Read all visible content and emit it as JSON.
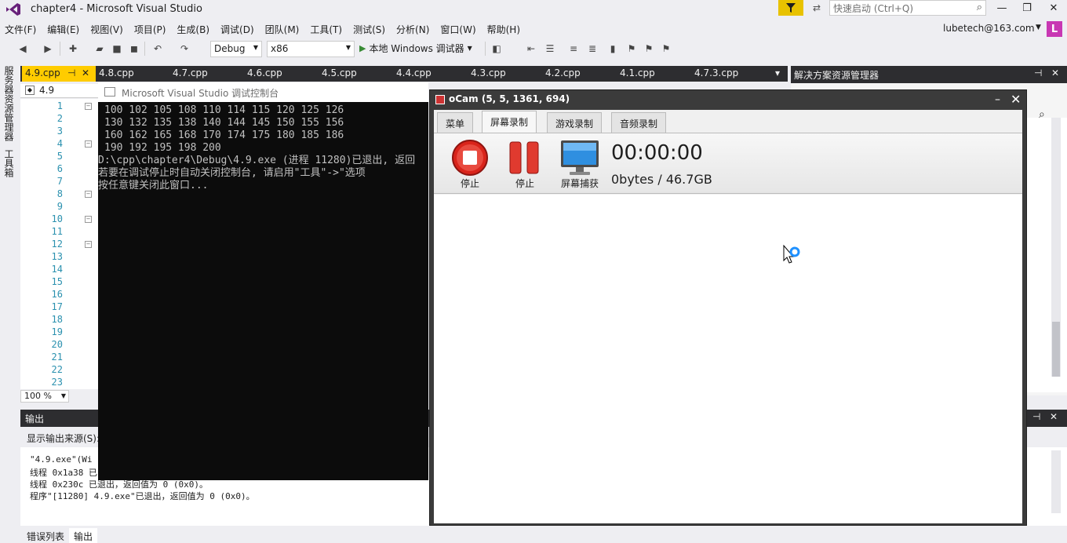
{
  "window": {
    "title": "chapter4 - Microsoft Visual Studio",
    "quick_launch_placeholder": "快速启动 (Ctrl+Q)",
    "account": "lubetech@163.com",
    "avatar_letter": "L"
  },
  "menu": [
    "文件(F)",
    "编辑(E)",
    "视图(V)",
    "项目(P)",
    "生成(B)",
    "调试(D)",
    "团队(M)",
    "工具(T)",
    "测试(S)",
    "分析(N)",
    "窗口(W)",
    "帮助(H)"
  ],
  "toolbar": {
    "config": "Debug",
    "platform": "x86",
    "run_label": "本地 Windows 调试器"
  },
  "left_strip": [
    "服务器资源管理器",
    "工具箱"
  ],
  "doc_tabs": [
    "4.9.cpp",
    "4.8.cpp",
    "4.7.cpp",
    "4.6.cpp",
    "4.5.cpp",
    "4.4.cpp",
    "4.3.cpp",
    "4.2.cpp",
    "4.1.cpp",
    "4.7.3.cpp"
  ],
  "editor": {
    "nav_scope": "4.9",
    "zoom": "100 %",
    "line_numbers": [
      "1",
      "2",
      "3",
      "4",
      "5",
      "6",
      "7",
      "8",
      "9",
      "10",
      "11",
      "12",
      "13",
      "14",
      "15",
      "16",
      "17",
      "18",
      "19",
      "20",
      "21",
      "22",
      "23"
    ]
  },
  "solution_explorer": {
    "title": "解决方案资源管理器"
  },
  "output": {
    "title": "输出",
    "source_label": "显示输出来源(S):",
    "lines": [
      "\"4.9.exe\"(Wi",
      "线程 0x1a38 已",
      "线程 0x230c 已退出，返回值为 0 (0x0)。",
      "程序\"[11280] 4.9.exe\"已退出，返回值为 0 (0x0)。"
    ]
  },
  "bottom_tabs": [
    "错误列表",
    "输出"
  ],
  "console": {
    "title": "Microsoft Visual Studio 调试控制台",
    "lines": [
      "100 102 105 108 110 114 115 120 125 126",
      "130 132 135 138 140 144 145 150 155 156",
      "160 162 165 168 170 174 175 180 185 186",
      "190 192 195 198 200",
      "D:\\cpp\\chapter4\\Debug\\4.9.exe (进程 11280)已退出, 返回",
      "若要在调试停止时自动关闭控制台, 请启用\"工具\"->\"选项",
      "按任意键关闭此窗口..."
    ]
  },
  "ocam": {
    "title": "oCam (5, 5, 1361, 694)",
    "tabs": [
      "菜单",
      "屏幕录制",
      "游戏录制",
      "音频录制"
    ],
    "buttons": [
      "停止",
      "停止",
      "屏幕捕获"
    ],
    "timer": "00:00:00",
    "bytes": "0bytes / 46.7GB"
  },
  "colors": {
    "vs_dark": "#2d2d30",
    "active_tab": "#ffcc00",
    "avatar": "#c837b3",
    "notify": "#e8c200",
    "record_red": "#d9241b"
  }
}
